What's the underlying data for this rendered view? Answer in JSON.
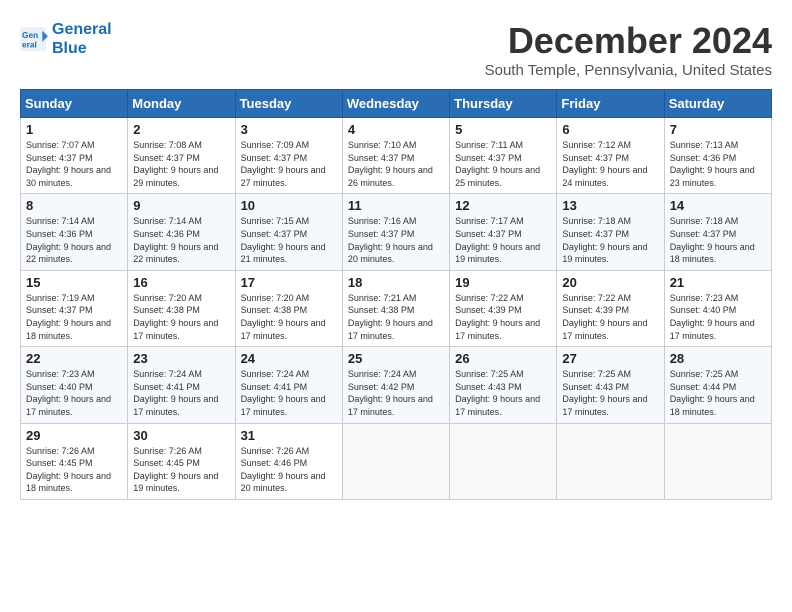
{
  "logo": {
    "line1": "General",
    "line2": "Blue"
  },
  "title": "December 2024",
  "subtitle": "South Temple, Pennsylvania, United States",
  "days_header": [
    "Sunday",
    "Monday",
    "Tuesday",
    "Wednesday",
    "Thursday",
    "Friday",
    "Saturday"
  ],
  "weeks": [
    [
      {
        "day": "1",
        "sunrise": "7:07 AM",
        "sunset": "4:37 PM",
        "daylight": "9 hours and 30 minutes."
      },
      {
        "day": "2",
        "sunrise": "7:08 AM",
        "sunset": "4:37 PM",
        "daylight": "9 hours and 29 minutes."
      },
      {
        "day": "3",
        "sunrise": "7:09 AM",
        "sunset": "4:37 PM",
        "daylight": "9 hours and 27 minutes."
      },
      {
        "day": "4",
        "sunrise": "7:10 AM",
        "sunset": "4:37 PM",
        "daylight": "9 hours and 26 minutes."
      },
      {
        "day": "5",
        "sunrise": "7:11 AM",
        "sunset": "4:37 PM",
        "daylight": "9 hours and 25 minutes."
      },
      {
        "day": "6",
        "sunrise": "7:12 AM",
        "sunset": "4:37 PM",
        "daylight": "9 hours and 24 minutes."
      },
      {
        "day": "7",
        "sunrise": "7:13 AM",
        "sunset": "4:36 PM",
        "daylight": "9 hours and 23 minutes."
      }
    ],
    [
      {
        "day": "8",
        "sunrise": "7:14 AM",
        "sunset": "4:36 PM",
        "daylight": "9 hours and 22 minutes."
      },
      {
        "day": "9",
        "sunrise": "7:14 AM",
        "sunset": "4:36 PM",
        "daylight": "9 hours and 22 minutes."
      },
      {
        "day": "10",
        "sunrise": "7:15 AM",
        "sunset": "4:37 PM",
        "daylight": "9 hours and 21 minutes."
      },
      {
        "day": "11",
        "sunrise": "7:16 AM",
        "sunset": "4:37 PM",
        "daylight": "9 hours and 20 minutes."
      },
      {
        "day": "12",
        "sunrise": "7:17 AM",
        "sunset": "4:37 PM",
        "daylight": "9 hours and 19 minutes."
      },
      {
        "day": "13",
        "sunrise": "7:18 AM",
        "sunset": "4:37 PM",
        "daylight": "9 hours and 19 minutes."
      },
      {
        "day": "14",
        "sunrise": "7:18 AM",
        "sunset": "4:37 PM",
        "daylight": "9 hours and 18 minutes."
      }
    ],
    [
      {
        "day": "15",
        "sunrise": "7:19 AM",
        "sunset": "4:37 PM",
        "daylight": "9 hours and 18 minutes."
      },
      {
        "day": "16",
        "sunrise": "7:20 AM",
        "sunset": "4:38 PM",
        "daylight": "9 hours and 17 minutes."
      },
      {
        "day": "17",
        "sunrise": "7:20 AM",
        "sunset": "4:38 PM",
        "daylight": "9 hours and 17 minutes."
      },
      {
        "day": "18",
        "sunrise": "7:21 AM",
        "sunset": "4:38 PM",
        "daylight": "9 hours and 17 minutes."
      },
      {
        "day": "19",
        "sunrise": "7:22 AM",
        "sunset": "4:39 PM",
        "daylight": "9 hours and 17 minutes."
      },
      {
        "day": "20",
        "sunrise": "7:22 AM",
        "sunset": "4:39 PM",
        "daylight": "9 hours and 17 minutes."
      },
      {
        "day": "21",
        "sunrise": "7:23 AM",
        "sunset": "4:40 PM",
        "daylight": "9 hours and 17 minutes."
      }
    ],
    [
      {
        "day": "22",
        "sunrise": "7:23 AM",
        "sunset": "4:40 PM",
        "daylight": "9 hours and 17 minutes."
      },
      {
        "day": "23",
        "sunrise": "7:24 AM",
        "sunset": "4:41 PM",
        "daylight": "9 hours and 17 minutes."
      },
      {
        "day": "24",
        "sunrise": "7:24 AM",
        "sunset": "4:41 PM",
        "daylight": "9 hours and 17 minutes."
      },
      {
        "day": "25",
        "sunrise": "7:24 AM",
        "sunset": "4:42 PM",
        "daylight": "9 hours and 17 minutes."
      },
      {
        "day": "26",
        "sunrise": "7:25 AM",
        "sunset": "4:43 PM",
        "daylight": "9 hours and 17 minutes."
      },
      {
        "day": "27",
        "sunrise": "7:25 AM",
        "sunset": "4:43 PM",
        "daylight": "9 hours and 17 minutes."
      },
      {
        "day": "28",
        "sunrise": "7:25 AM",
        "sunset": "4:44 PM",
        "daylight": "9 hours and 18 minutes."
      }
    ],
    [
      {
        "day": "29",
        "sunrise": "7:26 AM",
        "sunset": "4:45 PM",
        "daylight": "9 hours and 18 minutes."
      },
      {
        "day": "30",
        "sunrise": "7:26 AM",
        "sunset": "4:45 PM",
        "daylight": "9 hours and 19 minutes."
      },
      {
        "day": "31",
        "sunrise": "7:26 AM",
        "sunset": "4:46 PM",
        "daylight": "9 hours and 20 minutes."
      },
      null,
      null,
      null,
      null
    ]
  ]
}
